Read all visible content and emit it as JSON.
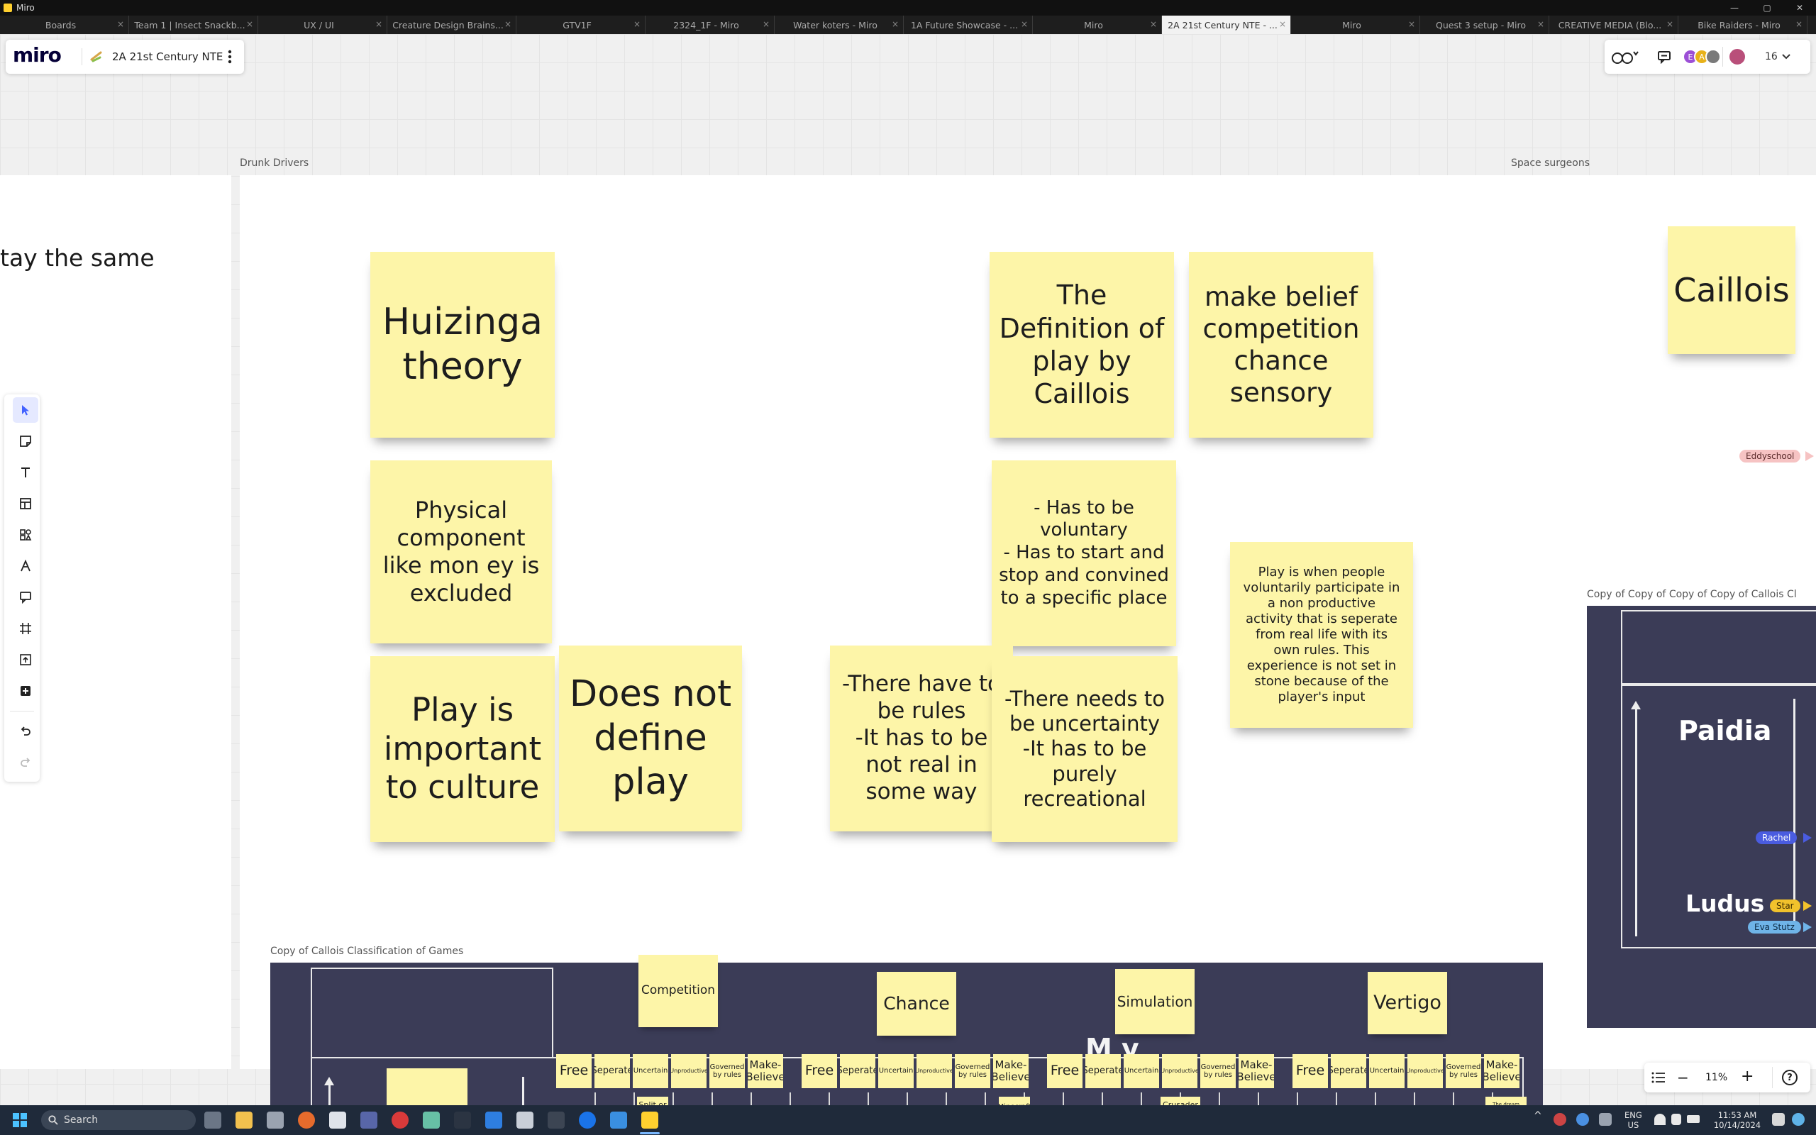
{
  "window": {
    "title": "Miro",
    "controls": [
      "—",
      "▢",
      "✕"
    ]
  },
  "tabs": [
    {
      "label": "Boards",
      "active": false
    },
    {
      "label": "Team 1 | Insect Snackb...",
      "active": false
    },
    {
      "label": "UX / UI",
      "active": false
    },
    {
      "label": "Creature Design Brains...",
      "active": false
    },
    {
      "label": "GTV1F",
      "active": false
    },
    {
      "label": "2324_1F - Miro",
      "active": false
    },
    {
      "label": "Water koters - Miro",
      "active": false
    },
    {
      "label": "1A Future Showcase - ...",
      "active": false
    },
    {
      "label": "Miro",
      "active": false
    },
    {
      "label": "2A 21st Century NTE - ...",
      "active": true
    },
    {
      "label": "Miro",
      "active": false
    },
    {
      "label": "Quest 3 setup - Miro",
      "active": false
    },
    {
      "label": "CREATIVE MEDIA (Blo...",
      "active": false
    },
    {
      "label": "Bike Raiders - Miro",
      "active": false
    }
  ],
  "board": {
    "logo": "miro",
    "name": "2A 21st Century NTE",
    "menu_icon": "more-vertical-icon"
  },
  "collab": {
    "online_count": "16",
    "avatars": [
      {
        "initial": "E",
        "color": "#9c4fd6"
      },
      {
        "initial": "A",
        "color": "#e8b21a"
      },
      {
        "initial": "",
        "color": "#7a7a7a"
      }
    ]
  },
  "frames": {
    "drunk_drivers": "Drunk Drivers",
    "space_surgeons": "Space surgeons",
    "left_partial_text": "tay the same",
    "copy_callois": "Copy of Callois Classification of Games",
    "copy_copy_callois": "Copy of Copy of Copy of Copy of Callois Cl"
  },
  "stickies": {
    "huizinga": "Huizinga theory",
    "physical": "Physical component like mon ey is excluded",
    "culture": "Play is important to culture",
    "not_define": "Does not define play",
    "definition": "The Definition of play by Caillois",
    "make_belief": "make belief competition chance sensory",
    "voluntary": "- Has to be voluntary\n- Has to start and stop and convined to a specific place",
    "play_is_when": "Play is when people voluntarily participate in a non productive activity that is seperate from real life with its own rules. This experience is not set in stone because of the player's input",
    "rules": "-There have to be rules\n-It has to be not real in some way",
    "uncertainty": "-There needs to be uncertainty\n-It has to be purely recreational",
    "caillois": "Caillois"
  },
  "right_panel": {
    "paidia": "Paidia",
    "ludus": "Ludus"
  },
  "cursors": [
    {
      "name": "Eddyschool",
      "color": "#f6c3c3",
      "text_color": "#5a2b2b"
    },
    {
      "name": "Rachel",
      "color": "#4a5ce0",
      "text_color": "#ffffff"
    },
    {
      "name": "Star",
      "color": "#f1c22c",
      "text_color": "#3b2b00"
    },
    {
      "name": "Eva Stutz",
      "color": "#6fb4e8",
      "text_color": "#0c2b45"
    }
  ],
  "bottom_frame": {
    "categories": [
      "Competition",
      "Chance",
      "Simulation",
      "Vertigo"
    ],
    "overlay_partial": "M     y",
    "column_labels": [
      "Free",
      "Seperate",
      "Uncertain",
      "Unproductive",
      "Governed by rules",
      "Make-Believe"
    ],
    "examples": [
      "Split or steal",
      "Minecraft",
      "Crusader Kings",
      "The dream stages in mario vs sonic olympic games"
    ]
  },
  "zoom": {
    "level": "11%",
    "minus": "−",
    "plus": "+",
    "help": "?"
  },
  "taskbar": {
    "search_placeholder": "Search",
    "lang": "ENG",
    "region": "US",
    "time": "11:53 AM",
    "date": "10/14/2024"
  }
}
